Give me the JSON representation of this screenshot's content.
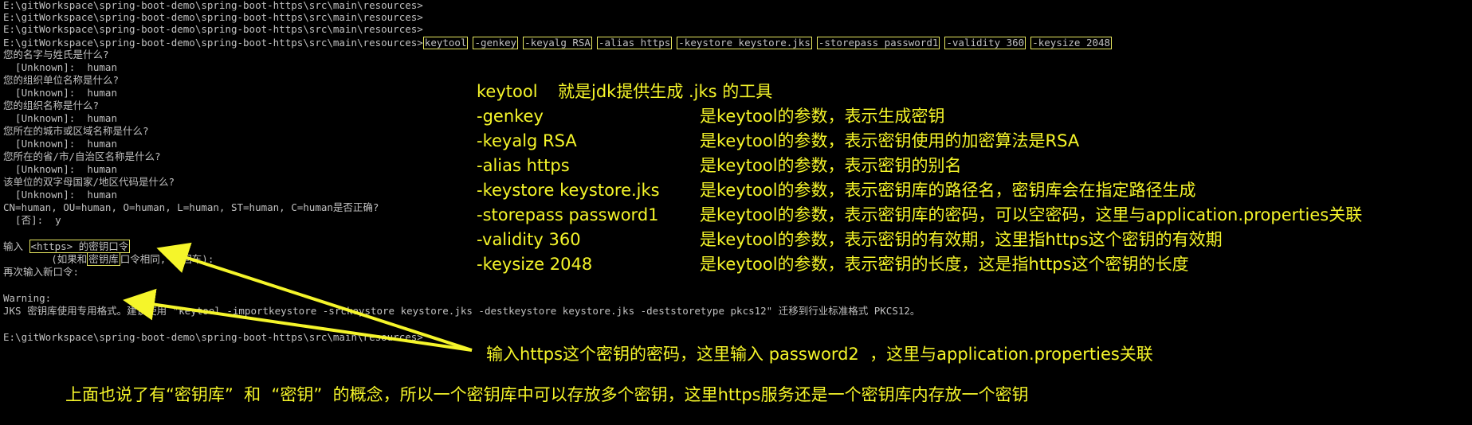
{
  "terminal": {
    "prompt_lines": [
      "E:\\gitWorkspace\\spring-boot-demo\\spring-boot-https\\src\\main\\resources>",
      "E:\\gitWorkspace\\spring-boot-demo\\spring-boot-https\\src\\main\\resources>",
      "E:\\gitWorkspace\\spring-boot-demo\\spring-boot-https\\src\\main\\resources>"
    ],
    "command_prompt": "E:\\gitWorkspace\\spring-boot-demo\\spring-boot-https\\src\\main\\resources>",
    "command_parts": [
      "keytool",
      "-genkey",
      "-keyalg RSA",
      "-alias https",
      "-keystore keystore.jks",
      "-storepass password1",
      "-validity 360",
      "-keysize 2048"
    ],
    "qa_lines": [
      "您的名字与姓氏是什么?",
      "  [Unknown]:  human",
      "您的组织单位名称是什么?",
      "  [Unknown]:  human",
      "您的组织名称是什么?",
      "  [Unknown]:  human",
      "您所在的城市或区域名称是什么?",
      "  [Unknown]:  human",
      "您所在的省/市/自治区名称是什么?",
      "  [Unknown]:  human",
      "该单位的双字母国家/地区代码是什么?",
      "  [Unknown]:  human",
      "CN=human, OU=human, O=human, L=human, ST=human, C=human是否正确?",
      "  [否]:  y"
    ],
    "input_prefix": "输入 ",
    "input_boxed": "<https> 的密钥口令",
    "same_pw_pre": "        (如果和",
    "same_pw_boxed": "密钥库",
    "same_pw_post": "口令相同, 按回车):",
    "reenter": "再次输入新口令:",
    "warning_title": "Warning:",
    "warning_text": "JKS 密钥库使用专用格式。建议使用 \"keytool -importkeystore -srckeystore keystore.jks -destkeystore keystore.jks -deststoretype pkcs12\" 迁移到行业标准格式 PKCS12。",
    "final_prompt": "E:\\gitWorkspace\\spring-boot-demo\\spring-boot-https\\src\\main\\resources>"
  },
  "annotations": {
    "keytool_term": "keytool",
    "keytool_desc": "就是jdk提供生成 .jks 的工具",
    "params": [
      {
        "term": "-genkey",
        "desc": "是keytool的参数，表示生成密钥"
      },
      {
        "term": "-keyalg RSA",
        "desc": "是keytool的参数，表示密钥使用的加密算法是RSA"
      },
      {
        "term": "-alias https",
        "desc": "是keytool的参数，表示密钥的别名"
      },
      {
        "term": "-keystore keystore.jks",
        "desc": "是keytool的参数，表示密钥库的路径名，密钥库会在指定路径生成"
      },
      {
        "term": "-storepass password1",
        "desc": "是keytool的参数，表示密钥库的密码，可以空密码，这里与application.properties关联"
      },
      {
        "term": "-validity 360",
        "desc": "是keytool的参数，表示密钥的有效期，这里指https这个密钥的有效期"
      },
      {
        "term": "-keysize 2048",
        "desc": "是keytool的参数，表示密钥的长度，这是指https这个密钥的长度"
      }
    ],
    "arrow_note": "输入https这个密钥的密码，这里输入 password2  ，这里与application.properties关联",
    "bottom_note": "上面也说了有“密钥库”  和  “密钥”  的概念，所以一个密钥库中可以存放多个密钥，这里https服务还是一个密钥库内存放一个密钥"
  },
  "colors": {
    "background": "#000000",
    "terminal_text": "#c0c0c0",
    "annotation": "#f5f52a",
    "box_border": "#e8e860"
  }
}
